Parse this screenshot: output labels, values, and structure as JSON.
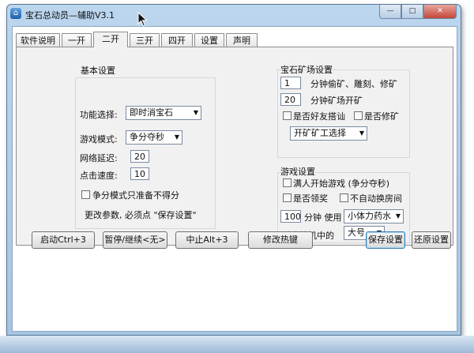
{
  "window": {
    "title": "宝石总动员—辅助V3.1",
    "icon": "house-icon",
    "min_glyph": "—",
    "max_glyph": "□",
    "close_glyph": "✕"
  },
  "tabs": [
    {
      "label": "软件说明"
    },
    {
      "label": "一开"
    },
    {
      "label": "二开",
      "active": true
    },
    {
      "label": "三开"
    },
    {
      "label": "四开"
    },
    {
      "label": "设置"
    },
    {
      "label": "声明"
    }
  ],
  "basic": {
    "title": "基本设置",
    "function_label": "功能选择:",
    "function_value": "即时消宝石",
    "mode_label": "游戏模式:",
    "mode_value": "争分夺秒",
    "delay_label": "网络延迟:",
    "delay_value": "20",
    "speed_label": "点击速度:",
    "speed_value": "10",
    "compete_check_label": "争分模式只准备不得分",
    "note": "更改参数, 必须点 \"保存设置\""
  },
  "mine": {
    "title": "宝石矿场设置",
    "minutes1_value": "1",
    "minutes1_label": "分钟偷矿、雕刻、修矿",
    "minutes2_value": "20",
    "minutes2_label": "分钟矿场开矿",
    "friend_check_label": "是否好友搭讪",
    "repair_check_label": "是否修矿",
    "work_select_value": "开矿矿工选择"
  },
  "game": {
    "title": "游戏设置",
    "full_start_label": "满人开始游戏 (争分夺秒)",
    "reward_label": "是否领奖",
    "no_switch_label": "不自动换房间",
    "minutes_value": "100",
    "minutes_use_label": "分钟 使用",
    "potion_value": "小体力药水",
    "battle_label": "对决挂机中的",
    "size_value": "大号"
  },
  "buttons": {
    "start": "启动Ctrl+3",
    "pause": "暂停/继续<无>",
    "stop": "中止Alt+3",
    "hotkey": "修改热键",
    "save": "保存设置",
    "restore": "还原设置"
  }
}
